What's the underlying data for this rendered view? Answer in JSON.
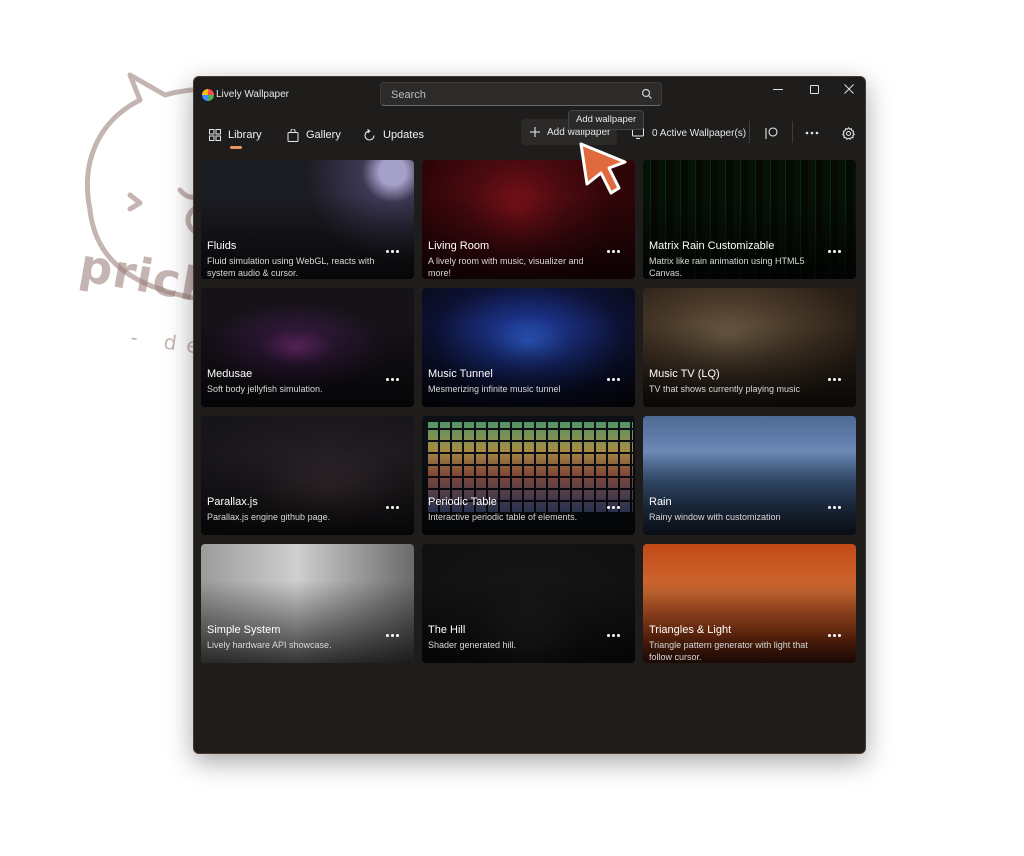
{
  "window": {
    "title": "Lively Wallpaper"
  },
  "search": {
    "placeholder": "Search"
  },
  "nav": {
    "library": "Library",
    "gallery": "Gallery",
    "updates": "Updates",
    "add_wallpaper": "Add wallpaper",
    "active_wallpapers": "0 Active Wallpaper(s)"
  },
  "tooltip": {
    "text": "Add wallpaper"
  },
  "watermark": {
    "text": "prickly pig",
    "subtext": "- design"
  },
  "cards": [
    {
      "title": "Fluids",
      "desc": "Fluid simulation using WebGL, reacts with system audio & cursor."
    },
    {
      "title": "Living Room",
      "desc": "A lively room with music, visualizer and more!"
    },
    {
      "title": "Matrix Rain Customizable",
      "desc": "Matrix like rain animation using HTML5 Canvas."
    },
    {
      "title": "Medusae",
      "desc": "Soft body jellyfish simulation."
    },
    {
      "title": "Music Tunnel",
      "desc": "Mesmerizing infinite music tunnel"
    },
    {
      "title": "Music TV (LQ)",
      "desc": "TV that shows currently playing music"
    },
    {
      "title": "Parallax.js",
      "desc": "Parallax.js engine github page."
    },
    {
      "title": "Periodic Table",
      "desc": "Interactive periodic table of elements."
    },
    {
      "title": "Rain",
      "desc": "Rainy window with customization"
    },
    {
      "title": "Simple System",
      "desc": "Lively hardware API showcase."
    },
    {
      "title": "The Hill",
      "desc": "Shader generated hill."
    },
    {
      "title": "Triangles & Light",
      "desc": "Triangle pattern generator with light that follow cursor."
    }
  ],
  "colors": {
    "accent": "#e89760",
    "background": "#1e1d1c",
    "cursor": "#e06a3e"
  }
}
